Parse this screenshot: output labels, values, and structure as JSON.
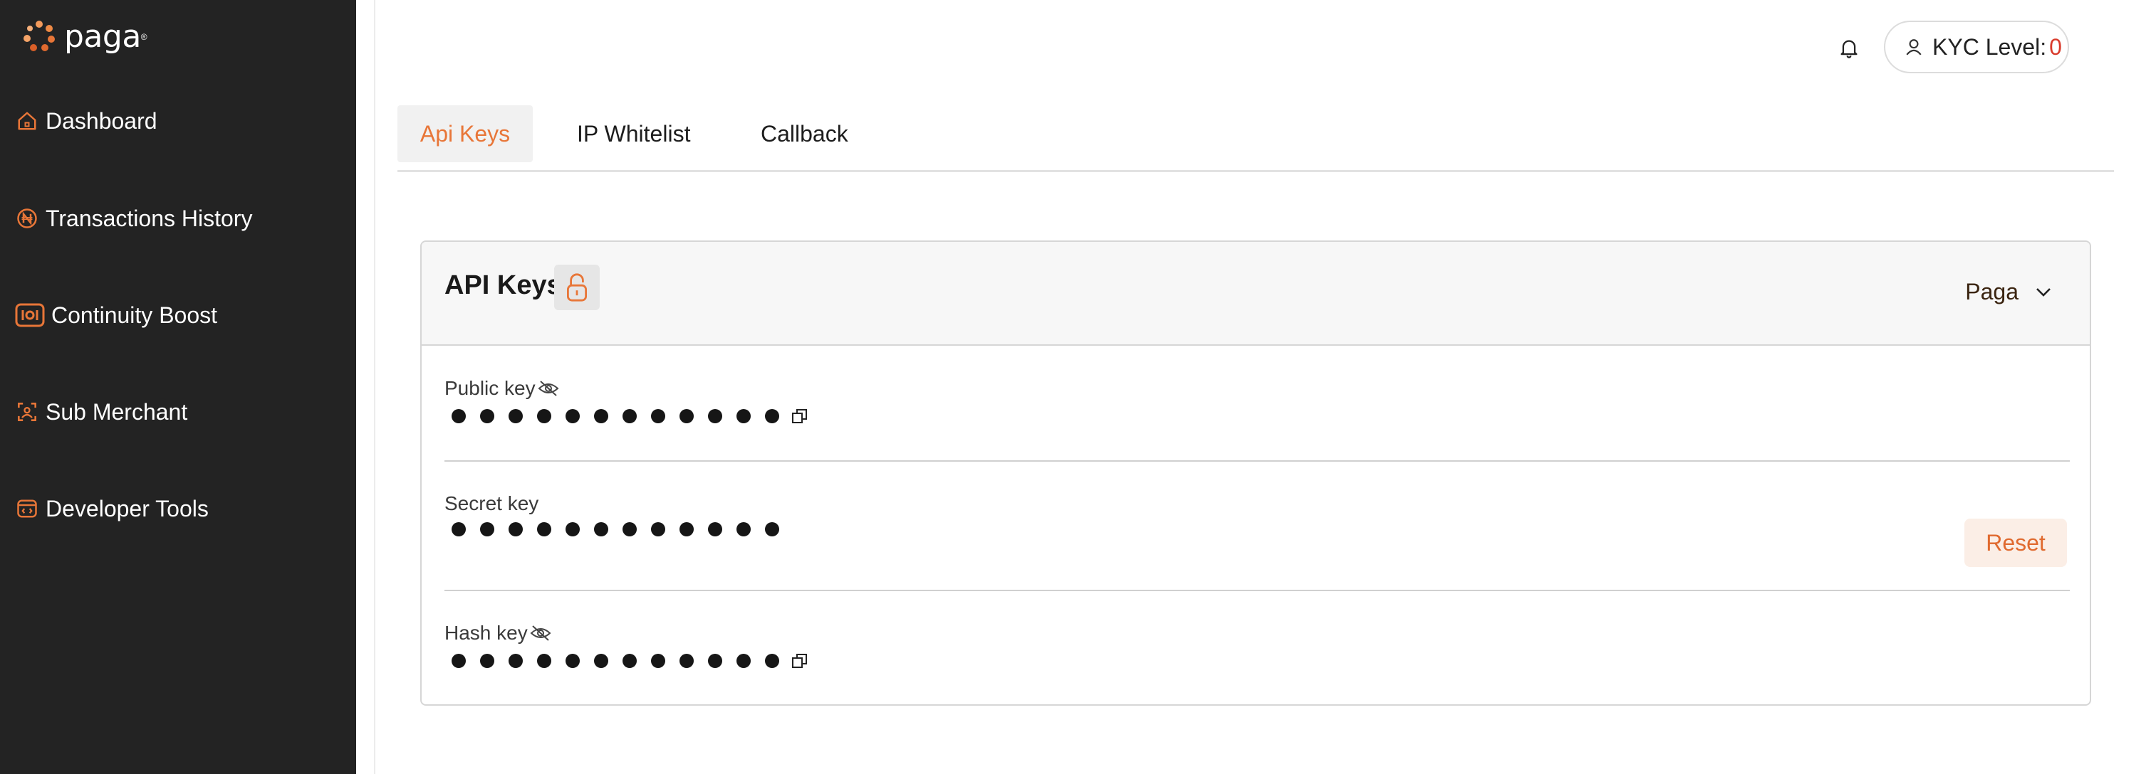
{
  "app": {
    "logo_text": "paga",
    "brand_color": "#e87638"
  },
  "sidebar": {
    "items": [
      {
        "label": "Dashboard",
        "icon": "home-icon"
      },
      {
        "label": "Transactions History",
        "icon": "naira-coin-icon"
      },
      {
        "label": "Continuity Boost",
        "icon": "boost-icon"
      },
      {
        "label": "Sub Merchant",
        "icon": "sub-merchant-icon"
      },
      {
        "label": "Developer Tools",
        "icon": "developer-tools-icon"
      }
    ]
  },
  "header": {
    "kyc_label": "KYC Level:",
    "kyc_value": "0"
  },
  "tabs": [
    {
      "label": "Api Keys",
      "active": true
    },
    {
      "label": "IP Whitelist",
      "active": false
    },
    {
      "label": "Callback",
      "active": false
    }
  ],
  "card": {
    "title": "API Keys",
    "dropdown_value": "Paga",
    "keys": [
      {
        "label": "Public key",
        "masked": "●●●●●●●●●●●●",
        "has_eye": true,
        "has_copy": true
      },
      {
        "label": "Secret key",
        "masked": "●●●●●●●●●●●●",
        "has_eye": false,
        "has_copy": false
      },
      {
        "label": "Hash key",
        "masked": "●●●●●●●●●●●●",
        "has_eye": true,
        "has_copy": true
      }
    ],
    "reset_label": "Reset"
  }
}
